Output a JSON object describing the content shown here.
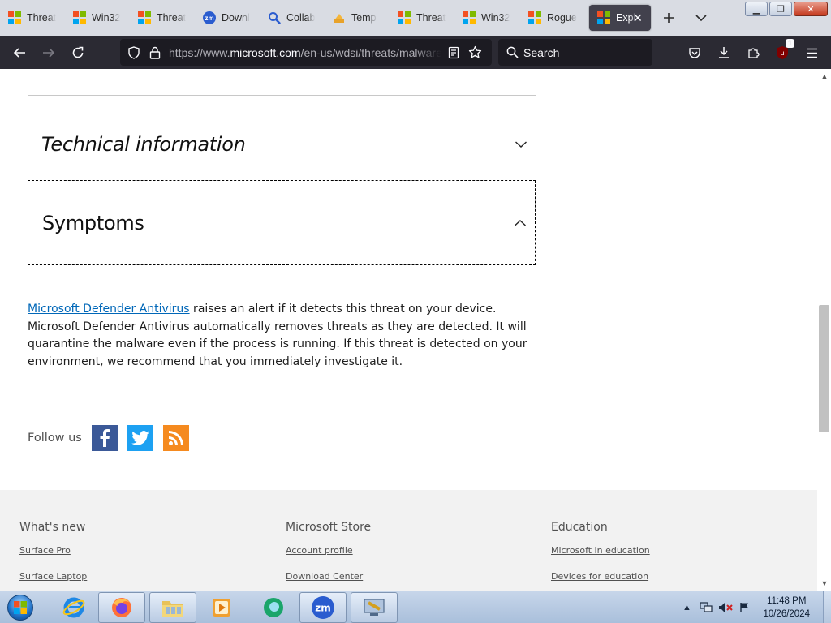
{
  "browser": {
    "tabs": [
      {
        "label": "Threat",
        "icon": "microsoft-icon"
      },
      {
        "label": "Win32",
        "icon": "microsoft-icon"
      },
      {
        "label": "Threat",
        "icon": "microsoft-icon"
      },
      {
        "label": "Downl",
        "icon": "zoom-icon"
      },
      {
        "label": "Collab",
        "icon": "search-icon"
      },
      {
        "label": "Temp",
        "icon": "temp-mail-icon"
      },
      {
        "label": "Threat",
        "icon": "microsoft-icon"
      },
      {
        "label": "Win32",
        "icon": "microsoft-icon"
      },
      {
        "label": "Rogue",
        "icon": "microsoft-icon"
      },
      {
        "label": "Expl",
        "icon": "microsoft-icon",
        "active": true
      }
    ],
    "url": {
      "prefix": "https://www.",
      "domain": "microsoft.com",
      "path": "/en-us/wdsi/threats/malware-encyclopedia-description"
    },
    "search_placeholder": "Search",
    "extension_badge": "1",
    "colors": {
      "toolbar": "#2b2a33",
      "urlbar": "#1c1b22",
      "tabstrip": "#d9dce3"
    }
  },
  "page": {
    "technical_title": "Technical information",
    "symptoms_title": "Symptoms",
    "body": {
      "link": "Microsoft Defender Antivirus",
      "text": " raises an alert if it detects this threat on your device. Microsoft Defender Antivirus automatically removes threats as they are detected. It will quarantine the malware even if the process is running. If this threat is detected on your environment, we recommend that you immediately investigate it."
    },
    "follow_label": "Follow us",
    "link_color": "#0067b8"
  },
  "footer": {
    "columns": [
      {
        "heading": "What's new",
        "links": [
          "Surface Pro",
          "Surface Laptop"
        ]
      },
      {
        "heading": "Microsoft Store",
        "links": [
          "Account profile",
          "Download Center"
        ]
      },
      {
        "heading": "Education",
        "links": [
          "Microsoft in education",
          "Devices for education"
        ]
      }
    ]
  },
  "taskbar": {
    "time": "11:48 PM",
    "date": "10/26/2024"
  }
}
